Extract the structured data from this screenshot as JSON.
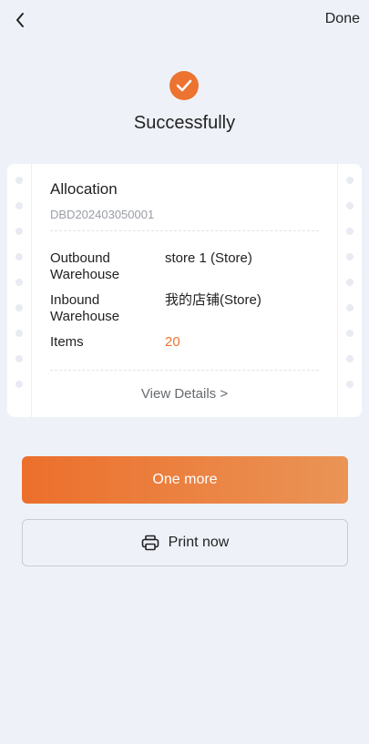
{
  "nav": {
    "back_icon": "chevron-left-icon",
    "done_label": "Done"
  },
  "status": {
    "icon": "check-circle-icon",
    "title": "Successfully",
    "accent_color": "#ec7330"
  },
  "card": {
    "title": "Allocation",
    "order_number": "DBD202403050001",
    "rows": [
      {
        "label": "Outbound Warehouse",
        "value": "store 1 (Store)"
      },
      {
        "label": "Inbound Warehouse",
        "value": "我的店铺(Store)"
      },
      {
        "label": "Items",
        "value": "20"
      }
    ],
    "view_details_label": "View Details >"
  },
  "actions": {
    "primary_label": "One more",
    "secondary_label": "Print now",
    "secondary_icon": "printer-icon"
  }
}
